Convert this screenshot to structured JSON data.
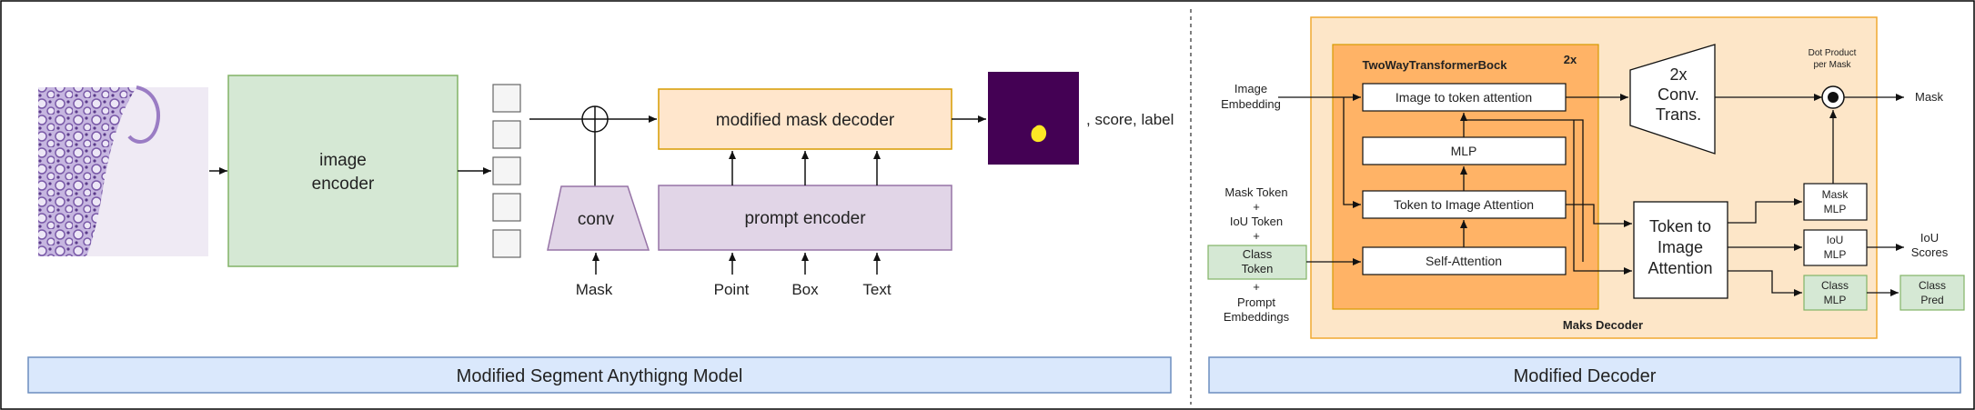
{
  "left": {
    "image_encoder": {
      "line1": "image",
      "line2": "encoder"
    },
    "mask_decoder": "modified mask decoder",
    "conv": "conv",
    "prompt_encoder": "prompt encoder",
    "output_suffix": ", score, label",
    "inputs": {
      "mask": "Mask",
      "point": "Point",
      "box": "Box",
      "text": "Text"
    },
    "caption": "Modified Segment Anythigng Model"
  },
  "right": {
    "inputs": {
      "image_embedding": [
        "Image",
        "Embedding"
      ],
      "mask_token": [
        "Mask Token",
        "+",
        "IoU Token",
        "+"
      ],
      "class_token": [
        "Class",
        "Token"
      ],
      "prompt_embeddings": [
        "+",
        "Prompt",
        "Embeddings"
      ]
    },
    "two_way": {
      "title": "TwoWayTransformerBock",
      "repeat": "2x"
    },
    "blocks": {
      "img2tok": "Image to token attention",
      "mlp": "MLP",
      "tok2img_small": "Token to Image Attention",
      "self_attn": "Self-Attention",
      "conv_trans": [
        "2x",
        "Conv.",
        "Trans."
      ],
      "tok2img_big": [
        "Token to",
        "Image",
        "Attention"
      ],
      "mask_mlp": [
        "Mask",
        "MLP"
      ],
      "iou_mlp": [
        "IoU",
        "MLP"
      ],
      "class_mlp": [
        "Class",
        "MLP"
      ],
      "class_pred": [
        "Class",
        "Pred"
      ]
    },
    "dot_product": [
      "Dot Product",
      "per Mask"
    ],
    "outputs": {
      "mask": "Mask",
      "iou": [
        "IoU",
        "Scores"
      ]
    },
    "decoder_label": "Maks Decoder",
    "caption": "Modified Decoder"
  },
  "colors": {
    "green_fill": "#d5e8d4",
    "green_stroke": "#82b366",
    "orange_fill": "#ffe6cc",
    "orange_stroke": "#d79b00",
    "purple_fill": "#e1d5e7",
    "purple_stroke": "#9673a6",
    "decoder_bg": "#fde6c8",
    "decoder_stroke": "#f0a830",
    "twoway_fill": "#ffb366",
    "caption_fill": "#dae8fc",
    "caption_stroke": "#6c8ebf",
    "mask_image": "#440154",
    "mask_blob": "#fde725",
    "tissue": "#9a7cc4"
  }
}
